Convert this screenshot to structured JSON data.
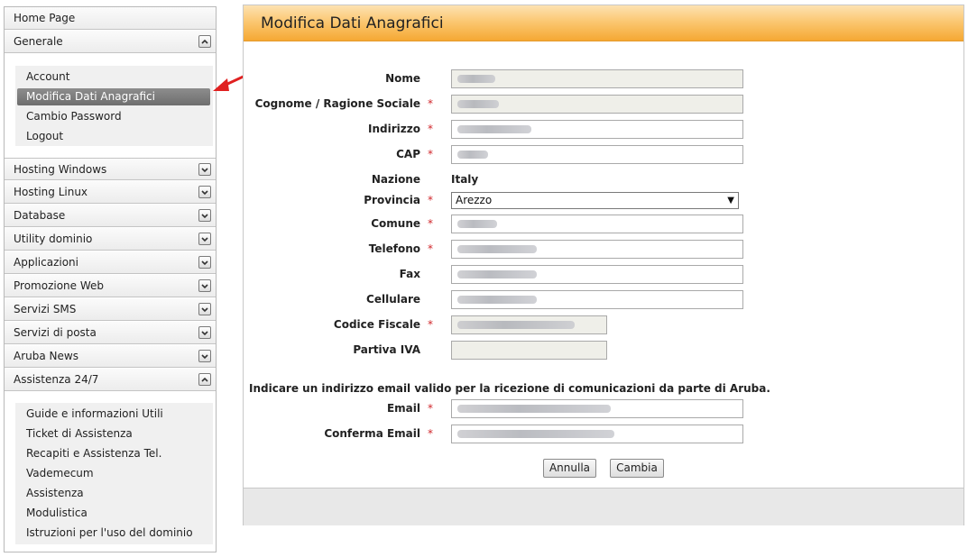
{
  "sidebar": {
    "home": "Home Page",
    "generale": "Generale",
    "generale_items": [
      "Account",
      "Modifica Dati Anagrafici",
      "Cambio Password",
      "Logout"
    ],
    "sections": [
      "Hosting Windows",
      "Hosting Linux",
      "Database",
      "Utility dominio",
      "Applicazioni",
      "Promozione Web",
      "Servizi SMS",
      "Servizi di posta",
      "Aruba News"
    ],
    "assistenza": "Assistenza 24/7",
    "assistenza_items": [
      "Guide e informazioni Utili",
      "Ticket di Assistenza",
      "Recapiti e Assistenza Tel.",
      "Vademecum",
      "Assistenza",
      "Modulistica",
      "Istruzioni per l'uso del dominio"
    ]
  },
  "form": {
    "title": "Modifica Dati Anagrafici",
    "labels": {
      "nome": "Nome",
      "cognome": "Cognome / Ragione Sociale",
      "indirizzo": "Indirizzo",
      "cap": "CAP",
      "nazione": "Nazione",
      "provincia": "Provincia",
      "comune": "Comune",
      "telefono": "Telefono",
      "fax": "Fax",
      "cellulare": "Cellulare",
      "codice_fiscale": "Codice Fiscale",
      "partiva_iva": "Partiva IVA",
      "email": "Email",
      "conferma_email": "Conferma Email"
    },
    "required_mark": "*",
    "nazione_value": "Italy",
    "provincia_value": "Arezzo",
    "email_note": "Indicare un indirizzo email valido per la ricezione di comunicazioni da parte di Aruba.",
    "buttons": {
      "annulla": "Annulla",
      "cambia": "Cambia"
    }
  },
  "colors": {
    "header_orange": "#f5a833",
    "active_item": "#777777",
    "required_red": "#d0262b",
    "arrow_red": "#e02020"
  }
}
